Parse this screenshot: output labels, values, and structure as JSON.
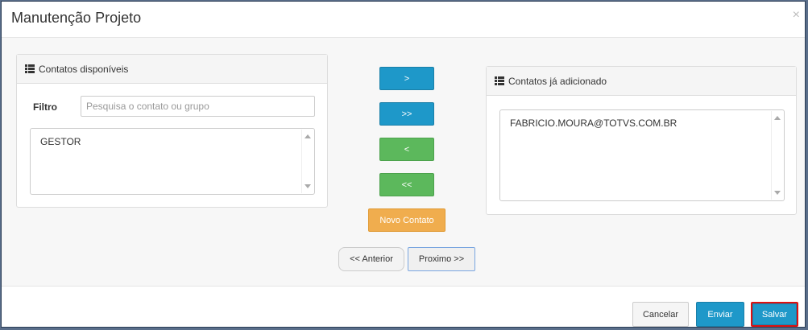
{
  "modal": {
    "title": "Manutenção Projeto",
    "close": "×"
  },
  "left_panel": {
    "heading": "Contatos disponíveis",
    "filter_label": "Filtro",
    "filter_placeholder": "Pesquisa o contato ou grupo",
    "filter_value": "",
    "items": [
      "GESTOR"
    ]
  },
  "right_panel": {
    "heading": "Contatos já adicionado",
    "items": [
      "FABRICIO.MOURA@TOTVS.COM.BR"
    ]
  },
  "transfer_buttons": {
    "add_selected": ">",
    "add_all": ">>",
    "remove_selected": "<",
    "remove_all": "<<"
  },
  "new_contact_label": "Novo Contato",
  "navigation": {
    "previous": "<< Anterior",
    "next": "Proximo >>"
  },
  "footer": {
    "cancel": "Cancelar",
    "send": "Enviar",
    "save": "Salvar"
  },
  "icons": {
    "list": "list-icon",
    "close": "close-icon"
  },
  "colors": {
    "primary": "#1e98c9",
    "success": "#5cb85c",
    "warning": "#f0ad4e",
    "highlight": "#dd1111"
  }
}
